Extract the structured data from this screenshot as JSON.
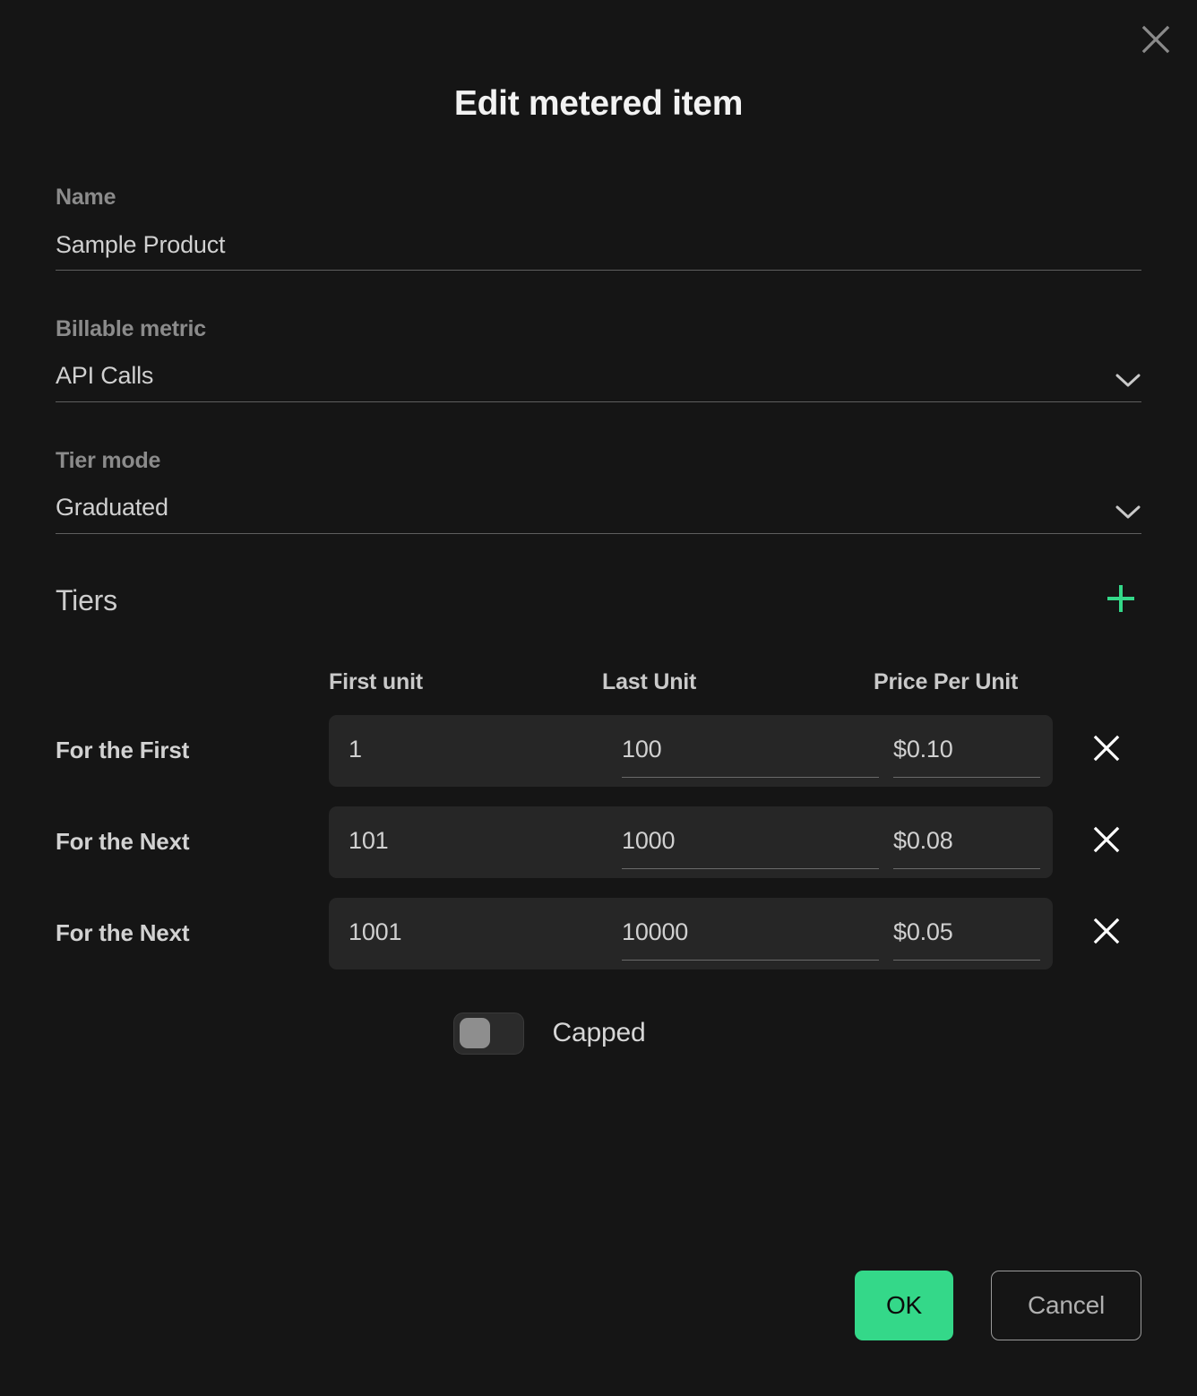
{
  "dialog": {
    "title": "Edit metered item",
    "close_icon": "close-icon"
  },
  "fields": {
    "name": {
      "label": "Name",
      "value": "Sample Product"
    },
    "billable_metric": {
      "label": "Billable metric",
      "value": "API Calls",
      "icon": "chevron-down-icon"
    },
    "tier_mode": {
      "label": "Tier mode",
      "value": "Graduated",
      "icon": "chevron-down-icon"
    }
  },
  "tiers": {
    "section_title": "Tiers",
    "add_icon": "plus-icon",
    "columns": {
      "first_unit": "First unit",
      "last_unit": "Last Unit",
      "price_per_unit": "Price Per Unit"
    },
    "rows": [
      {
        "label": "For the First",
        "first_unit": "1",
        "last_unit": "100",
        "price_per_unit": "$0.10",
        "delete_icon": "close-icon"
      },
      {
        "label": "For the Next",
        "first_unit": "101",
        "last_unit": "1000",
        "price_per_unit": "$0.08",
        "delete_icon": "close-icon"
      },
      {
        "label": "For the Next",
        "first_unit": "1001",
        "last_unit": "10000",
        "price_per_unit": "$0.05",
        "delete_icon": "close-icon"
      }
    ],
    "capped": {
      "label": "Capped",
      "checked": false
    }
  },
  "footer": {
    "ok_label": "OK",
    "cancel_label": "Cancel"
  },
  "colors": {
    "background": "#151515",
    "panel": "#262626",
    "accent_green": "#34d889",
    "label_gray": "#8b8b8b",
    "value_gray": "#d0d0d0"
  }
}
